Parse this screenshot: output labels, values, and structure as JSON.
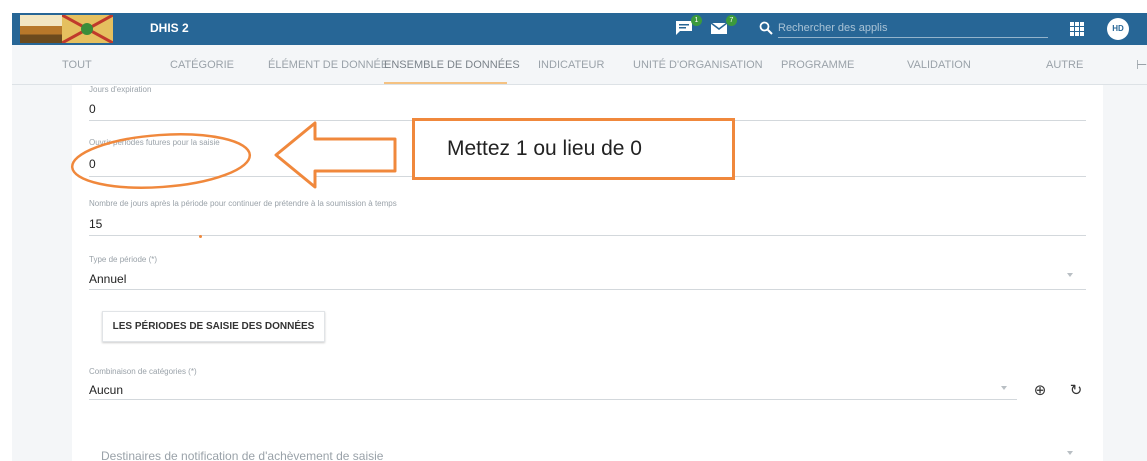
{
  "header": {
    "app_title": "DHIS 2",
    "interpretations_badge": "1",
    "messages_badge": "7",
    "search_placeholder": "Rechercher des applis",
    "user_initials": "HD",
    "bar_color": "#276696"
  },
  "tabs": [
    {
      "label": "TOUT"
    },
    {
      "label": "CATÉGORIE"
    },
    {
      "label": "ÉLÉMENT DE DONNÉE"
    },
    {
      "label": "ENSEMBLE DE DONNÉES",
      "active": true
    },
    {
      "label": "INDICATEUR"
    },
    {
      "label": "UNITÉ D'ORGANISATION"
    },
    {
      "label": "PROGRAMME"
    },
    {
      "label": "VALIDATION"
    },
    {
      "label": "AUTRE"
    }
  ],
  "form": {
    "expiry_days": {
      "label": "Jours d'expiration",
      "value": "0"
    },
    "open_future_periods": {
      "label": "Ouvrir périodes futures pour la saisie",
      "value": "0"
    },
    "timely_days": {
      "label": "Nombre de jours après la période pour continuer de prétendre à la soumission à temps",
      "value": "15"
    },
    "period_type": {
      "label": "Type de période (*)",
      "value": "Annuel"
    },
    "periods_button": "LES PÉRIODES DE SAISIE DES DONNÉES",
    "category_combo": {
      "label": "Combinaison de catégories (*)",
      "value": "Aucun"
    },
    "notification_recipients": {
      "placeholder": "Destinaires de notification de d'achèvement de saisie"
    }
  },
  "annotation": {
    "callout_text": "Mettez 1 ou lieu de 0",
    "color": "#f0883c"
  }
}
